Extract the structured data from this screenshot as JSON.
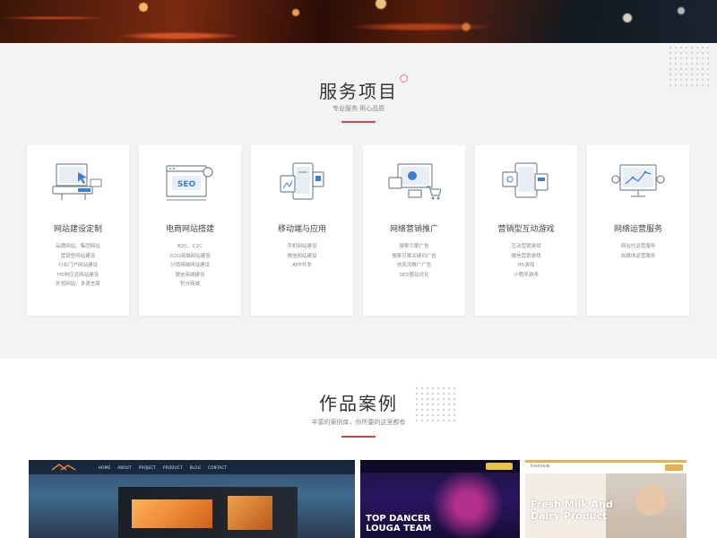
{
  "services": {
    "title": "服务项目",
    "subtitle": "专业服务·用心品质",
    "cards": [
      {
        "icon": "computer-design-icon",
        "title": "网站建设定制",
        "items": [
          "品牌网站、集团网站",
          "营销型网站建设",
          "行业门户网站建设",
          "H5响应式网站建设",
          "外贸网站、多语言版"
        ]
      },
      {
        "icon": "seo-browser-icon",
        "title": "电商网站搭建",
        "items": [
          "B2C、C2C",
          "O2O商城网站建设",
          "分销商城网站建设",
          "微信商城建设",
          "积分商城"
        ]
      },
      {
        "icon": "mobile-app-icon",
        "title": "移动端与应用",
        "items": [
          "手机网站建设",
          "微信网站建设",
          "APP开发"
        ]
      },
      {
        "icon": "marketing-cart-icon",
        "title": "网络营销推广",
        "items": [
          "搜索引擎广告",
          "搜索引擎关键词广告",
          "信息流推广广告",
          "SEO整站优化"
        ]
      },
      {
        "icon": "interactive-game-icon",
        "title": "营销型互动游戏",
        "items": [
          "互动营销游戏",
          "微信营销游戏",
          "H5游戏",
          "小程序游戏"
        ]
      },
      {
        "icon": "analytics-monitor-icon",
        "title": "网络运营服务",
        "items": [
          "网站代运营服务",
          "自媒体运营服务"
        ]
      }
    ]
  },
  "works": {
    "title": "作品案例",
    "subtitle": "丰富的案例库，你所要的这里都有",
    "cases": [
      {
        "nav": [
          "HOME",
          "ABOUT",
          "PROJECT",
          "PRODUCT",
          "BLOG",
          "CONTACT"
        ]
      },
      {
        "headline_line1": "TOP DANCER",
        "headline_line2": "LOUGA TEAM"
      },
      {
        "brand": "Freshmilk",
        "headline_line1": "Fresh Milk And",
        "headline_line2": "Dairy Product"
      }
    ]
  },
  "colors": {
    "accent": "#c9464b",
    "section_bg": "#f2f4f3",
    "icon_stroke": "#7b8794",
    "icon_accent": "#3f7fd1"
  }
}
